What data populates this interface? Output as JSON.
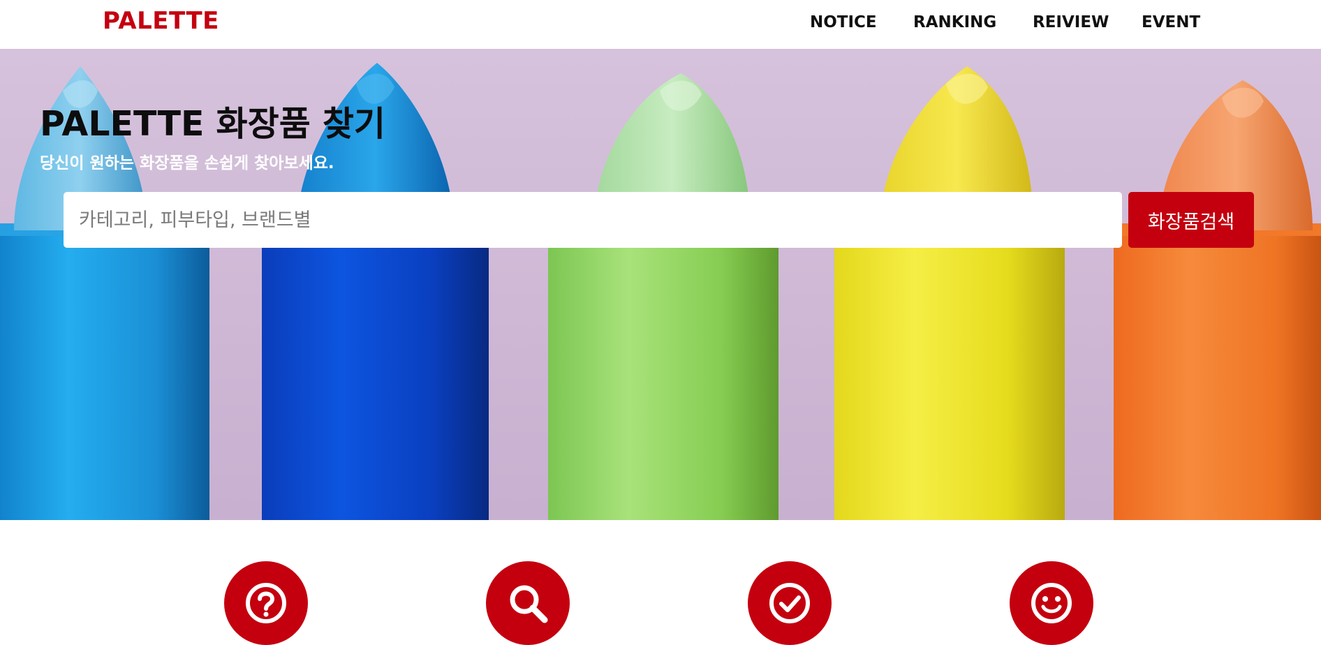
{
  "header": {
    "logo": "PALETTE",
    "nav": [
      {
        "label": "NOTICE"
      },
      {
        "label": "RANKING"
      },
      {
        "label": "REIVIEW"
      },
      {
        "label": "EVENT"
      }
    ]
  },
  "hero": {
    "title": "PALETTE 화장품 찾기",
    "subtitle": "당신이 원하는 화장품을 손쉽게 찾아보세요.",
    "search": {
      "placeholder": "카테고리, 피부타입, 브랜드별",
      "value": "",
      "button_label": "화장품검색"
    },
    "background": {
      "description_colors": [
        "#1aa2e4",
        "#0a4fd6",
        "#8fd86a",
        "#efe63a",
        "#f07a2c"
      ],
      "backdrop": "#d2bdd8"
    }
  },
  "features": [
    {
      "icon": "question-icon"
    },
    {
      "icon": "search-icon"
    },
    {
      "icon": "check-circle-icon"
    },
    {
      "icon": "smile-icon"
    }
  ],
  "colors": {
    "accent": "#c4000f",
    "text_dark": "#111111",
    "white": "#ffffff"
  }
}
